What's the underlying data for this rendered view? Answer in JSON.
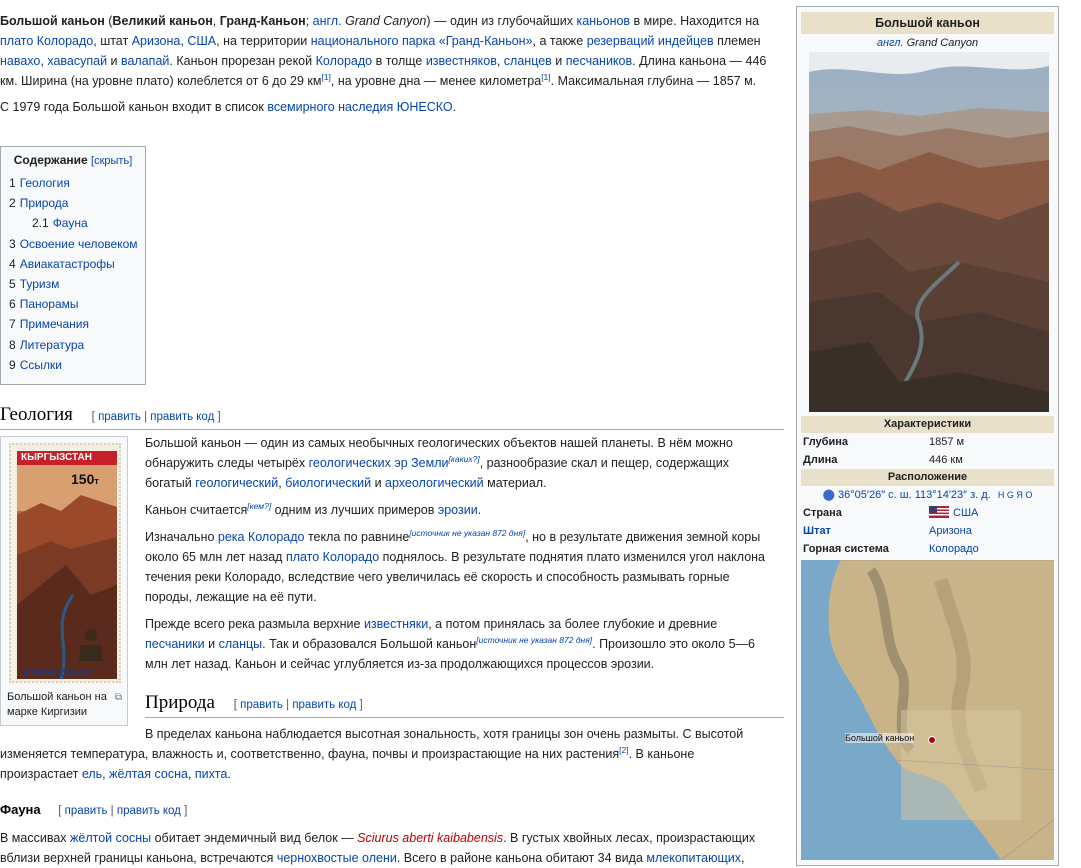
{
  "intro": {
    "p1": [
      {
        "t": "Большой каньон",
        "s": "b"
      },
      {
        "t": " ("
      },
      {
        "t": "Великий каньон",
        "s": "b"
      },
      {
        "t": ", "
      },
      {
        "t": "Гранд-Каньон",
        "s": "b"
      },
      {
        "t": "; "
      },
      {
        "t": "англ.",
        "s": "a"
      },
      {
        "t": " "
      },
      {
        "t": "Grand Canyon",
        "s": "i"
      },
      {
        "t": ") — один из глубочайших "
      },
      {
        "t": "каньонов",
        "s": "a"
      },
      {
        "t": " в мире. Находится на "
      },
      {
        "t": "плато Колорадо",
        "s": "a"
      },
      {
        "t": ", штат "
      },
      {
        "t": "Аризона",
        "s": "a"
      },
      {
        "t": ", "
      },
      {
        "t": "США",
        "s": "a"
      },
      {
        "t": ", на территории "
      },
      {
        "t": "национального парка «Гранд-Каньон»",
        "s": "a"
      },
      {
        "t": ", а также "
      },
      {
        "t": "резерваций индейцев",
        "s": "a"
      },
      {
        "t": " племен "
      },
      {
        "t": "навахо",
        "s": "a"
      },
      {
        "t": ", "
      },
      {
        "t": "хавасупай",
        "s": "a"
      },
      {
        "t": " и "
      },
      {
        "t": "валапай",
        "s": "a"
      },
      {
        "t": ". Каньон прорезан рекой "
      },
      {
        "t": "Колорадо",
        "s": "a"
      },
      {
        "t": " в толще "
      },
      {
        "t": "известняков",
        "s": "a"
      },
      {
        "t": ", "
      },
      {
        "t": "сланцев",
        "s": "a"
      },
      {
        "t": " и "
      },
      {
        "t": "песчаников",
        "s": "a"
      },
      {
        "t": ". Длина каньона — 446 км. Ширина (на уровне плато) колеблется от 6 до 29 км"
      },
      {
        "t": "[1]",
        "s": "sup"
      },
      {
        "t": ", на уровне дна — менее километра"
      },
      {
        "t": "[1]",
        "s": "sup"
      },
      {
        "t": ". Максимальная глубина — 1857 м."
      }
    ],
    "p2": [
      {
        "t": "С 1979 года Большой каньон входит в список "
      },
      {
        "t": "всемирного наследия ЮНЕСКО",
        "s": "a"
      },
      {
        "t": "."
      }
    ]
  },
  "toc": {
    "title": "Содержание",
    "toggle": "[скрыть]",
    "items": [
      {
        "num": "1",
        "label": "Геология",
        "sub": false
      },
      {
        "num": "2",
        "label": "Природа",
        "sub": false
      },
      {
        "num": "2.1",
        "label": "Фауна",
        "sub": true
      },
      {
        "num": "3",
        "label": "Освоение человеком",
        "sub": false
      },
      {
        "num": "4",
        "label": "Авиакатастрофы",
        "sub": false
      },
      {
        "num": "5",
        "label": "Туризм",
        "sub": false
      },
      {
        "num": "6",
        "label": "Панорамы",
        "sub": false
      },
      {
        "num": "7",
        "label": "Примечания",
        "sub": false
      },
      {
        "num": "8",
        "label": "Литература",
        "sub": false
      },
      {
        "num": "9",
        "label": "Ссылки",
        "sub": false
      }
    ]
  },
  "edit": {
    "open": "[",
    "edit": "править",
    "sep": " | ",
    "edit_code": "править код",
    "close": "]"
  },
  "geology": {
    "heading": "Геология",
    "p1": [
      {
        "t": "Большой каньон — один из самых необычных геологических объектов нашей планеты. В нём можно обнаружить следы четырёх "
      },
      {
        "t": "геологических эр Земли",
        "s": "a"
      },
      {
        "t": "[каких?]",
        "s": "supi"
      },
      {
        "t": ", разнообразие скал и пещер, содержащих богатый "
      },
      {
        "t": "геологический",
        "s": "a"
      },
      {
        "t": ", "
      },
      {
        "t": "биологический",
        "s": "a"
      },
      {
        "t": " и "
      },
      {
        "t": "археологический",
        "s": "a"
      },
      {
        "t": " материал."
      }
    ],
    "p2": [
      {
        "t": "Каньон считается"
      },
      {
        "t": "[кем?]",
        "s": "supi"
      },
      {
        "t": " одним из лучших примеров "
      },
      {
        "t": "эрозии",
        "s": "a"
      },
      {
        "t": "."
      }
    ],
    "p3": [
      {
        "t": "Изначально "
      },
      {
        "t": "река Колорадо",
        "s": "a"
      },
      {
        "t": " текла по равнине"
      },
      {
        "t": "[источник не указан 872 дня]",
        "s": "supi"
      },
      {
        "t": ", но в результате движения земной коры около 65 млн лет назад "
      },
      {
        "t": "плато Колорадо",
        "s": "a"
      },
      {
        "t": " поднялось. В результате поднятия плато изменился угол наклона течения реки Колорадо, вследствие чего увеличилась её скорость и способность размывать горные породы, лежащие на её пути."
      }
    ],
    "p4": [
      {
        "t": "Прежде всего река размыла верхние "
      },
      {
        "t": "известняки",
        "s": "a"
      },
      {
        "t": ", а потом принялась за более глубокие и древние "
      },
      {
        "t": "песчаники",
        "s": "a"
      },
      {
        "t": " и "
      },
      {
        "t": "сланцы",
        "s": "a"
      },
      {
        "t": ". Так и образовался Большой каньон"
      },
      {
        "t": "[источник не указан 872 дня]",
        "s": "supi"
      },
      {
        "t": ". Произошло это около 5—6 млн лет назад. Каньон и сейчас углубляется из-за продолжающихся процессов эрозии."
      }
    ]
  },
  "stamp": {
    "country": "КЫРГЫЗСТАН",
    "country_latin": "KYRGYZSTAN",
    "value": "150",
    "currency": "т",
    "caption": "Большой каньон на марке Киргизии",
    "magnify": "⧉"
  },
  "nature": {
    "heading": "Природа",
    "p1": [
      {
        "t": "В пределах каньона наблюдается высотная зональность, хотя границы зон очень размыты. С высотой изменяется температура, влажность и, соответственно, фауна, почвы и произрастающие на них растения"
      },
      {
        "t": "[2]",
        "s": "sup"
      },
      {
        "t": ". В каньоне произрастает "
      },
      {
        "t": "ель",
        "s": "a"
      },
      {
        "t": ", "
      },
      {
        "t": "жёлтая сосна",
        "s": "a"
      },
      {
        "t": ", "
      },
      {
        "t": "пихта",
        "s": "a"
      },
      {
        "t": "."
      }
    ]
  },
  "fauna": {
    "heading": "Фауна",
    "p1": [
      {
        "t": "В массивах "
      },
      {
        "t": "жёлтой сосны",
        "s": "a"
      },
      {
        "t": " обитает эндемичный вид белок — "
      },
      {
        "t": "Sciurus aberti kaibabensis",
        "s": "red"
      },
      {
        "t": ". В густых хвойных лесах, произрастающих вблизи верхней границы каньона, встречаются "
      },
      {
        "t": "чернохвостые олени",
        "s": "a"
      },
      {
        "t": ". Всего в районе каньона обитают 34 вида "
      },
      {
        "t": "млекопитающих",
        "s": "a"
      },
      {
        "t": ","
      }
    ]
  },
  "infobox": {
    "title": "Большой каньон",
    "subtitle_lang": "англ.",
    "subtitle": "Grand Canyon",
    "characteristics": "Характеристики",
    "depth_label": "Глубина",
    "depth_value": "1857 м",
    "length_label": "Длина",
    "length_value": "446 км",
    "location": "Расположение",
    "coords": "36°05′26″ с. ш. 113°14′23″ з. д.",
    "coords_tail": "H G Я O",
    "country_label": "Страна",
    "country_value": "США",
    "state_label": "Штат",
    "state_value": "Аризона",
    "mountain_label": "Горная система",
    "mountain_value": "Колорадо",
    "map_label": "Большой каньон"
  },
  "colors": {
    "link": "#0645ad",
    "redlink": "#ba0000",
    "header_bg": "#e8e0c8",
    "text": "#202122"
  }
}
